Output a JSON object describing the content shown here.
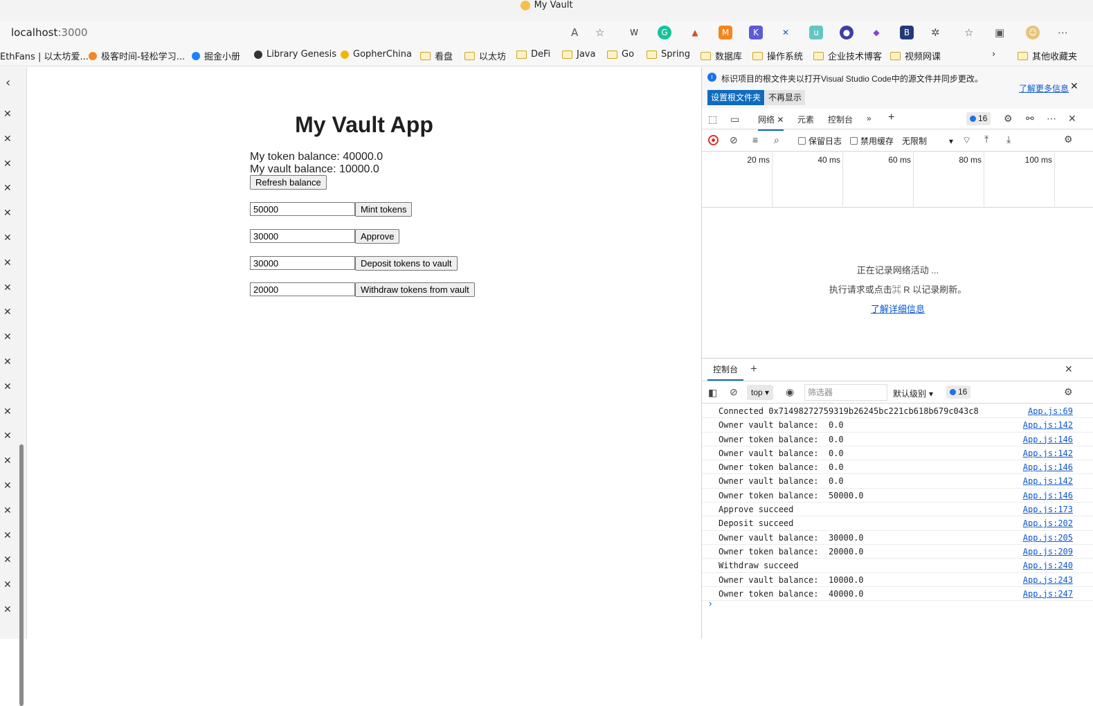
{
  "window": {
    "title": "My Vault"
  },
  "address_bar": {
    "host": "localhost",
    "port": ":3000"
  },
  "bookmarks": [
    {
      "label": "EthFans | 以太坊爱...",
      "type": "site"
    },
    {
      "label": "极客时间-轻松学习...",
      "type": "site"
    },
    {
      "label": "掘金小册",
      "type": "site"
    },
    {
      "label": "Library Genesis",
      "type": "site"
    },
    {
      "label": "GopherChina",
      "type": "site"
    },
    {
      "label": "看盘",
      "type": "folder"
    },
    {
      "label": "以太坊",
      "type": "folder"
    },
    {
      "label": "DeFi",
      "type": "folder"
    },
    {
      "label": "Java",
      "type": "folder"
    },
    {
      "label": "Go",
      "type": "folder"
    },
    {
      "label": "Spring",
      "type": "folder"
    },
    {
      "label": "数据库",
      "type": "folder"
    },
    {
      "label": "操作系统",
      "type": "folder"
    },
    {
      "label": "企业技术博客",
      "type": "folder"
    },
    {
      "label": "视频网课",
      "type": "folder"
    },
    {
      "label": "其他收藏夹",
      "type": "folder"
    }
  ],
  "page": {
    "title": "My Vault App",
    "token_balance": "My token balance: 40000.0",
    "vault_balance": "My vault balance: 10000.0",
    "refresh_label": "Refresh balance",
    "mint": {
      "value": "50000",
      "label": "Mint tokens"
    },
    "approve": {
      "value": "30000",
      "label": "Approve"
    },
    "deposit": {
      "value": "30000",
      "label": "Deposit tokens to vault"
    },
    "withdraw": {
      "value": "20000",
      "label": "Withdraw tokens from vault"
    }
  },
  "devtools": {
    "info_text": "标识项目的根文件夹以打开Visual Studio Code中的源文件并同步更改。",
    "learn_more": "了解更多信息",
    "set_root": "设置根文件夹",
    "dont_show": "不再显示",
    "tabs": {
      "network": "网络",
      "elements": "元素",
      "console": "控制台"
    },
    "issues_count": "16",
    "net_toolbar": {
      "preserve_log": "保留日志",
      "disable_cache": "禁用缓存",
      "throttle": "无限制"
    },
    "timeline_ticks": [
      "20 ms",
      "40 ms",
      "60 ms",
      "80 ms",
      "100 ms"
    ],
    "net_empty": {
      "line1": "正在记录网络活动 ...",
      "line2": "执行请求或点击⌘ R 以记录刷新。",
      "link": "了解详细信息"
    },
    "drawer_tab": "控制台",
    "console_toolbar": {
      "context": "top",
      "filter_placeholder": "筛选器",
      "level": "默认级别",
      "issues": "16"
    },
    "console_log": [
      {
        "msg": "Connected 0x71498272759319b26245bc221cb618b679c043c8",
        "src": "App.js:69"
      },
      {
        "msg": "Owner vault balance:  0.0",
        "src": "App.js:142"
      },
      {
        "msg": "Owner token balance:  0.0",
        "src": "App.js:146"
      },
      {
        "msg": "Owner vault balance:  0.0",
        "src": "App.js:142"
      },
      {
        "msg": "Owner token balance:  0.0",
        "src": "App.js:146"
      },
      {
        "msg": "Owner vault balance:  0.0",
        "src": "App.js:142"
      },
      {
        "msg": "Owner token balance:  50000.0",
        "src": "App.js:146"
      },
      {
        "msg": "Approve succeed",
        "src": "App.js:173"
      },
      {
        "msg": "Deposit succeed",
        "src": "App.js:202"
      },
      {
        "msg": "Owner vault balance:  30000.0",
        "src": "App.js:205"
      },
      {
        "msg": "Owner token balance:  20000.0",
        "src": "App.js:209"
      },
      {
        "msg": "Withdraw succeed",
        "src": "App.js:240"
      },
      {
        "msg": "Owner vault balance:  10000.0",
        "src": "App.js:243"
      },
      {
        "msg": "Owner token balance:  40000.0",
        "src": "App.js:247"
      }
    ]
  }
}
